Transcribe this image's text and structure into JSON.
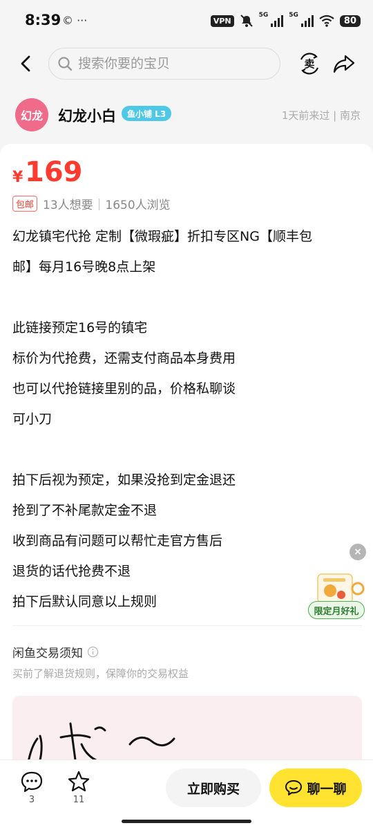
{
  "status_bar": {
    "time": "8:39",
    "left_icons": "© ···",
    "vpn": "VPN",
    "net1": "5G",
    "net2": "5G",
    "battery": "80"
  },
  "header": {
    "search_placeholder": "搜索你要的宝贝",
    "sell_glyph": "卖"
  },
  "seller": {
    "avatar_text": "幻龙",
    "name": "幻龙小白",
    "badge": "鱼小铺 L3",
    "meta": "1天前来过 | 南京"
  },
  "product": {
    "currency": "¥",
    "price": "169",
    "free_shipping": "包邮",
    "wants": "13人想要",
    "views": "1650人浏览",
    "description_lines": [
      "幻龙镇宅代抢 定制【微瑕疵】折扣专区NG【顺丰包",
      "邮】每月16号晚8点上架",
      "",
      "此链接预定16号的镇宅",
      "标价为代抢费，还需支付商品本身费用",
      "也可以代抢链接里别的品，价格私聊谈",
      "可小刀",
      "",
      "拍下后视为预定，如果没抢到定金退还",
      "抢到了不补尾款定金不退",
      "收到商品有问题可以帮忙走官方售后",
      "退货的话代抢费不退",
      "拍下后默认同意以上规则"
    ]
  },
  "promo": {
    "label": "限定月好礼",
    "close": "×"
  },
  "notice": {
    "title": "闲鱼交易须知",
    "subtitle": "买前了解退货规则，保障你的交易权益"
  },
  "bottom_bar": {
    "comment_count": "3",
    "favorite_count": "11",
    "buy_label": "立即购买",
    "chat_label": "聊一聊"
  },
  "colors": {
    "price": "#ff3b30",
    "chat_button": "#ffe330",
    "badge": "#4fc8e8",
    "avatar": "#f06a8a"
  }
}
